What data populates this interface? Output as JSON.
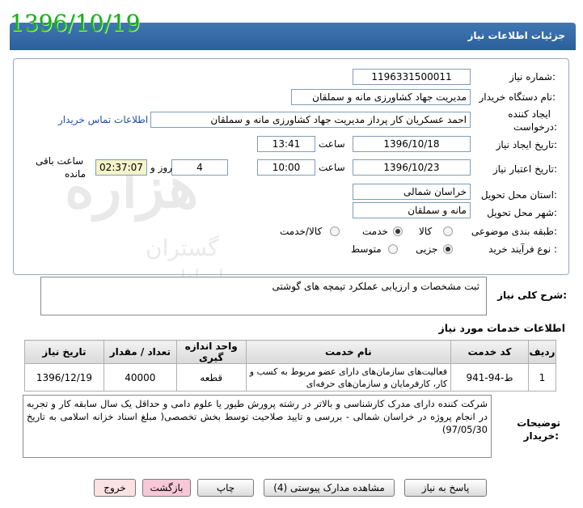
{
  "header": {
    "title": "جزئیات اطلاعات نیاز",
    "date_stamp": "1396/10/19"
  },
  "form": {
    "need_number_label": "شماره نیاز:",
    "need_number": "1196331500011",
    "buyer_org_label": "نام دستگاه خریدار:",
    "buyer_org": "مدیریت جهاد کشاورزی مانه و سملقان",
    "creator_label_1": "ایجاد کننده",
    "creator_label_2": "درخواست:",
    "creator": "احمد عسکریان کار پرداز مدیریت جهاد کشاورزی مانه و سملقان",
    "contact_link": "اطلاعات تماس خریدار",
    "created_date_label": "تاریخ ایجاد نیاز:",
    "created_date": "1396/10/18",
    "time_label": "ساعت",
    "created_time": "13:41",
    "valid_date_label": "تاریخ اعتبار نیاز:",
    "valid_date": "1396/10/23",
    "valid_time": "10:00",
    "days_value": "4",
    "days_label": "روز و",
    "remaining_time": "02:37:07",
    "remaining_label_1": "ساعت باقی",
    "remaining_label_2": "مانده",
    "province_label": "استان محل تحویل:",
    "province": "خراسان شمالی",
    "city_label": "شهر محل تحویل:",
    "city": "مانه و سملقان",
    "category_label": "طبقه بندی موضوعی:",
    "category_options": [
      "کالا",
      "خدمت",
      "کالا/خدمت"
    ],
    "category_selected": "خدمت",
    "process_label": "نوع فرآیند خرید :",
    "process_options": [
      "جزیی",
      "متوسط"
    ],
    "process_selected": "جزیی"
  },
  "description": {
    "label": "شرح کلی نیاز:",
    "text": "ثبت مشخصات و ارزیابی عملکرد تیمچه های گوشتی"
  },
  "services": {
    "title": "اطلاعات خدمات مورد نیاز",
    "columns": [
      "ردیف",
      "کد خدمت",
      "نام خدمت",
      "واحد اندازه گیری",
      "تعداد / مقدار",
      "تاریخ نیاز"
    ],
    "rows": [
      [
        "1",
        "ط-94-941",
        "فعالیت‌های سازمان‌های دارای عضو مربوط به کسب و کار، کارفرمایان و سازمان‌های حرفه‌ای",
        "قطعه",
        "40000",
        "1396/12/19"
      ]
    ]
  },
  "buyer_notes": {
    "label_1": "توضیحات",
    "label_2": "خریدار:",
    "text": "شرکت کننده دارای مدرک کارشناسی و بالاتر در رشته پرورش طیور یا علوم دامی و حداقل یک سال سابقه کار و تجربه در انجام پروژه در خراسان شمالی - بررسی و تایید صلاحیت توسط بخش تخصصی(  مبلغ اسناد خزانه اسلامی به تاریخ 97/05/30)"
  },
  "watermark": {
    "line1": "هزاره",
    "line2": "گستران",
    "line3": "ارتباط"
  },
  "buttons": {
    "respond": "پاسخ به نیاز",
    "docs": "مشاهده مدارک پیوستی (4)",
    "print": "چاپ",
    "back": "بازگشت",
    "exit": "خروج"
  },
  "colors": {
    "header": "#2f6aa8",
    "stamp": "#1aae1a",
    "back_btn": "#f7c8d8",
    "exit_btn": "#fde2e2"
  }
}
